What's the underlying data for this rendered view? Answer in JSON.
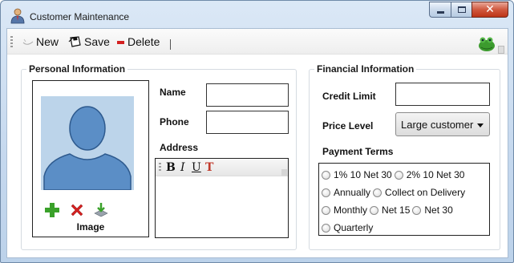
{
  "window": {
    "title": "Customer Maintenance",
    "controls": {
      "minimize": "minimize-icon",
      "maximize": "maximize-icon",
      "close": "close-icon"
    }
  },
  "toolbar": {
    "new_label": "New",
    "save_label": "Save",
    "delete_label": "Delete",
    "separator": "|"
  },
  "personal": {
    "title": "Personal Information",
    "image_label": "Image",
    "name_label": "Name",
    "name_value": "",
    "phone_label": "Phone",
    "phone_value": "",
    "address_label": "Address",
    "address_value": "",
    "format_buttons": [
      "B",
      "I",
      "U",
      "T"
    ]
  },
  "financial": {
    "title": "Financial Information",
    "credit_limit_label": "Credit Limit",
    "credit_limit_value": "",
    "price_level_label": "Price Level",
    "price_level_value": "Large customer",
    "payment_terms_label": "Payment Terms",
    "payment_terms": [
      "1% 10 Net 30",
      "2% 10 Net 30",
      "Annually",
      "Collect on Delivery",
      "Monthly",
      "Net 15",
      "Net 30",
      "Quarterly"
    ]
  },
  "colors": {
    "add_green": "#3aa12a",
    "delete_red": "#d32020",
    "close_red": "#c8442a",
    "photo_bg": "#bcd4ea",
    "silhouette": "#5b8ec6"
  }
}
